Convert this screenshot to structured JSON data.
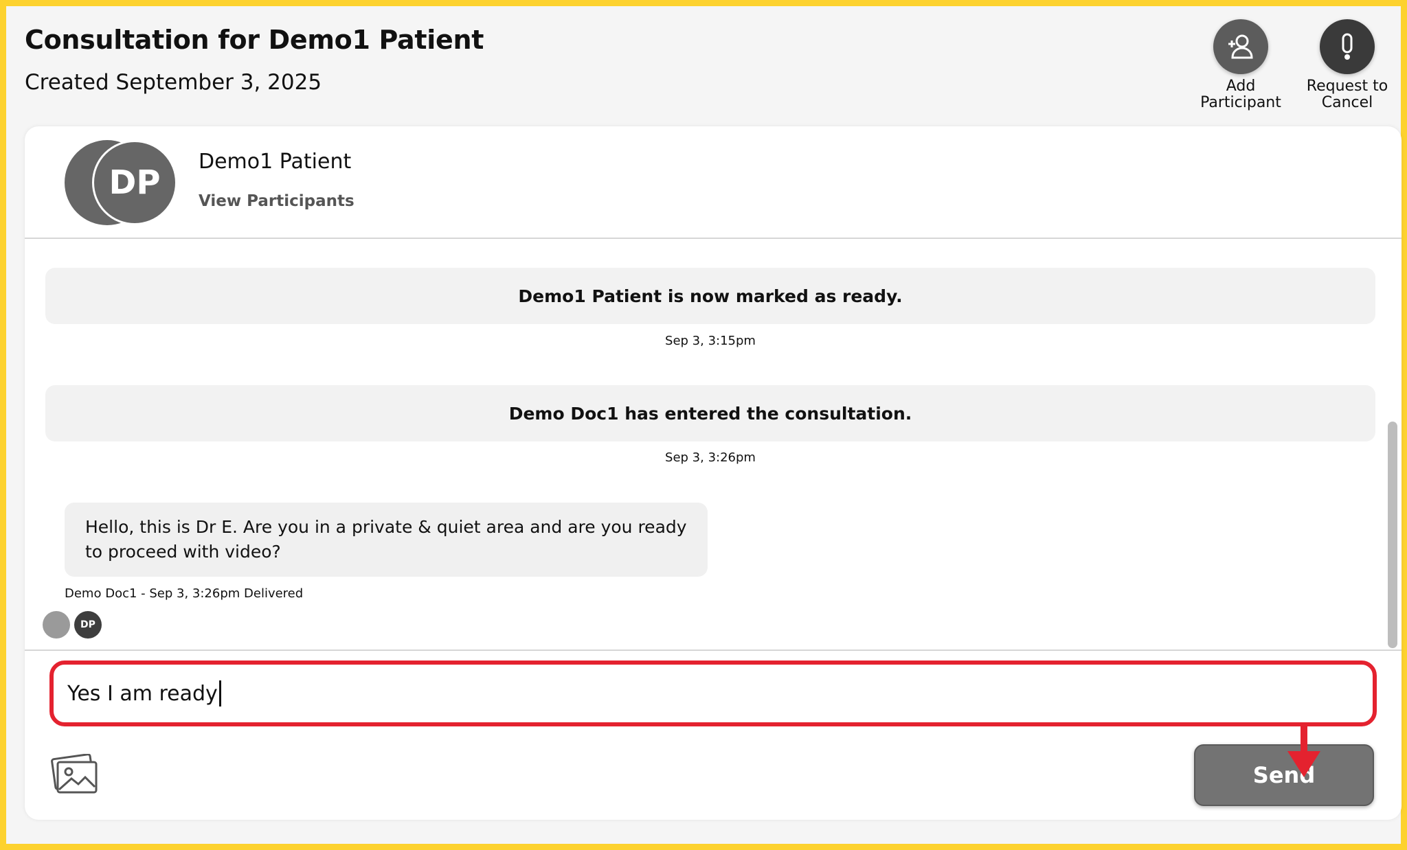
{
  "header": {
    "title": "Consultation for Demo1 Patient",
    "created": "Created September 3, 2025",
    "actions": [
      {
        "label_line1": "Add",
        "label_line2": "Participant",
        "icon": "add-person-icon"
      },
      {
        "label_line1": "Request to",
        "label_line2": "Cancel",
        "icon": "exclamation-icon"
      }
    ]
  },
  "participant": {
    "initials": "DP",
    "name": "Demo1 Patient",
    "view_link": "View Participants"
  },
  "messages": {
    "system": [
      {
        "text": "Demo1 Patient is now marked as ready.",
        "time": "Sep 3, 3:15pm"
      },
      {
        "text": "Demo Doc1 has entered the consultation.",
        "time": "Sep 3, 3:26pm"
      }
    ],
    "chat": {
      "text": "Hello, this is Dr E. Are you in a private & quiet area and are you ready to proceed with video?",
      "meta": "Demo Doc1 - Sep 3, 3:26pm Delivered",
      "read_by_initials": "DP"
    }
  },
  "composer": {
    "value": "Yes I am ready",
    "image_icon": "image-gallery-icon",
    "send_label": "Send"
  },
  "colors": {
    "frame": "#fdd22f",
    "highlight": "#e4222f",
    "button_grey": "#737373"
  }
}
